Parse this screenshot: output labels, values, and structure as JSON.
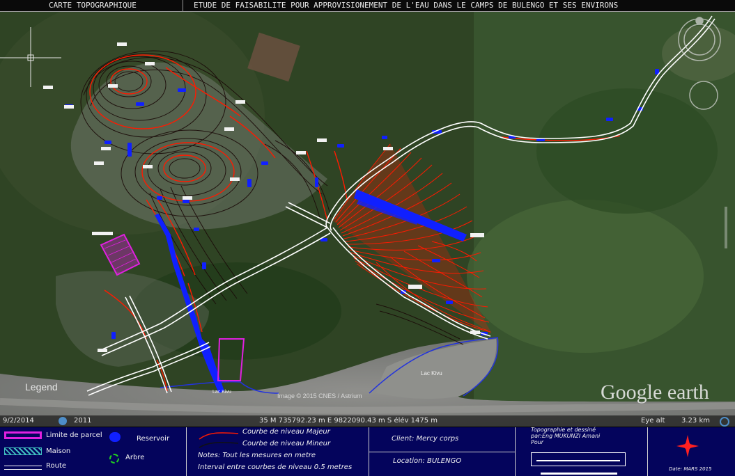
{
  "header": {
    "left_title": "CARTE TOPOGRAPHIQUE",
    "right_title": "ETUDE DE FAISABILITE POUR APPROVISIONEMENT DE L'EAU DANS LE CAMPS DE BULENGO ET SES ENVIRONS"
  },
  "map": {
    "legend_heading": "Legend",
    "lake_labels": [
      "Lac Kivu",
      "Lac Kivu"
    ],
    "watermark": "Google earth",
    "imagery_credit": "Image © 2015 CNES / Astrium",
    "colors": {
      "major_contour": "#ff1a00",
      "minor_contour": "#1a0a08",
      "reservoir": "#1020ff",
      "route": "#ffffff",
      "parcel_limit": "#e020e0",
      "shoreline": "#2233dd"
    }
  },
  "status_bar": {
    "date": "9/2/2014",
    "year": "2011",
    "coordinates": "35 M 735792.23 m E 9822090.43 m S élév 1475 m",
    "eye_alt_label": "Eye alt",
    "eye_alt_value": "3.23 km"
  },
  "legend": {
    "items": [
      {
        "icon": "parcel-limit-icon",
        "label": "Limite de parcel"
      },
      {
        "icon": "house-icon",
        "label": "Maison"
      },
      {
        "icon": "route-icon",
        "label": "Route"
      },
      {
        "icon": "reservoir-icon",
        "label": "Reservoir"
      },
      {
        "icon": "tree-icon",
        "label": "Arbre"
      }
    ],
    "major_contour": "Courbe de niveau Majeur",
    "minor_contour": "Courbe de niveau Mineur",
    "notes": "Notes:  Tout les mesures en metre",
    "interval": "Interval entre courbes de niveau  0.5 metres"
  },
  "info": {
    "client": "Client: Mercy corps",
    "location": "Location: BULENGO",
    "topographer_line1": "Topographie et dessiné",
    "topographer_line2": "par:Eng MUKUNZI Amani",
    "topographer_line3": "Pour",
    "date": "Date: MARS 2015"
  }
}
